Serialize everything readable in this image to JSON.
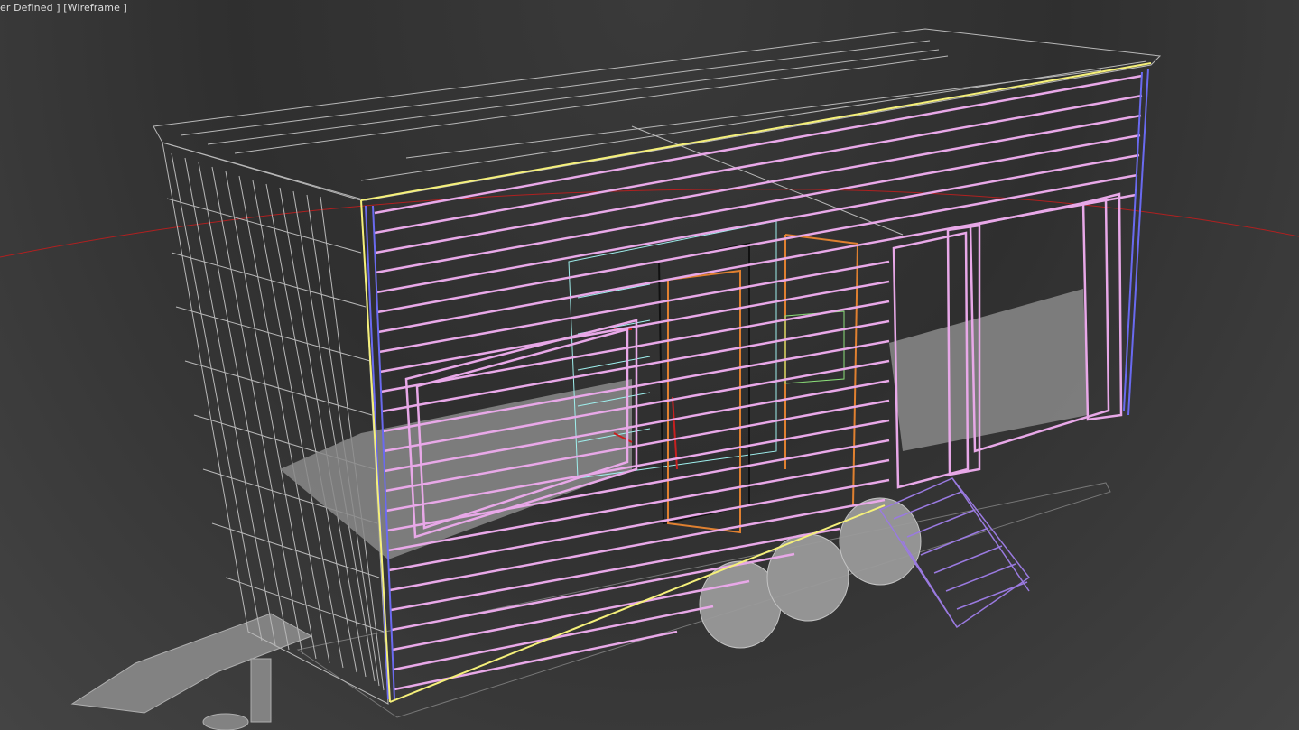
{
  "viewport": {
    "view_label": "er Defined ]",
    "shading_label": "[Wireframe ]",
    "shading_mode": "Wireframe"
  },
  "colors": {
    "background": "#2b2b2b",
    "frame_gray": "#b8b8b8",
    "selected_pink": "#e8a8e8",
    "selected_outline": "#f5f07a",
    "edge_blue": "#6a6af0",
    "cyan_object": "#9ff0ee",
    "orange_object": "#e08030",
    "red_object": "#c82020",
    "green_object": "#8ce07a",
    "stairs_purple": "#9a7ae0",
    "horizon_red": "#b02020",
    "mesh_fill_gray": "#8a8a8a"
  }
}
